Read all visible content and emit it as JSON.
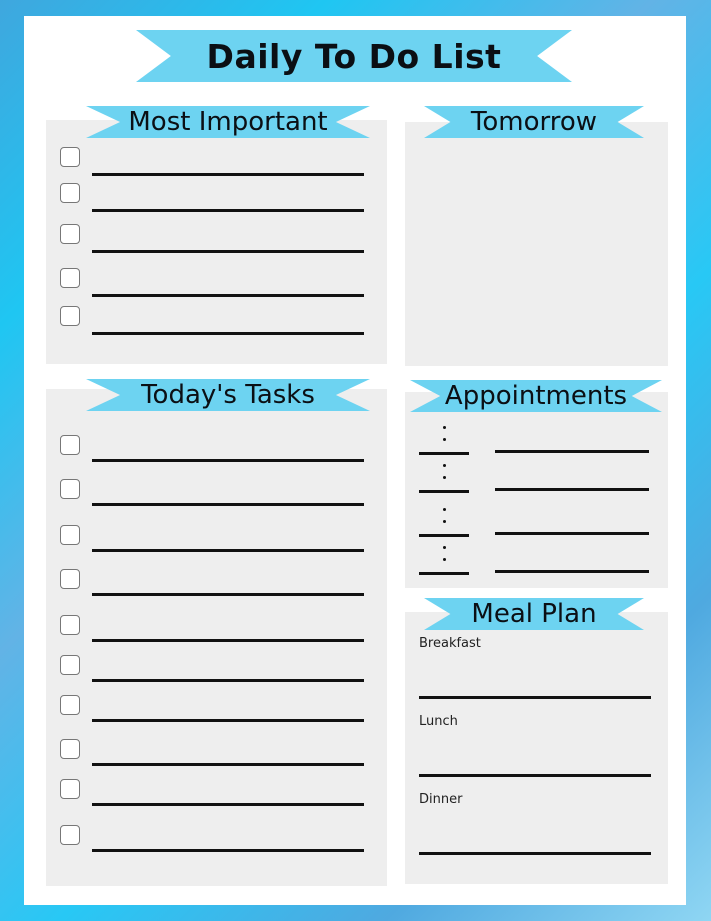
{
  "colors": {
    "ribbon": "#6dd3f1",
    "panel": "#eeeeee",
    "paper": "#ffffff",
    "border_accent": "#1fc6f2"
  },
  "title": "Daily To Do List",
  "sections": {
    "most_important": {
      "label": "Most Important",
      "checkbox_count": 5,
      "checked": [
        false,
        false,
        false,
        false,
        false
      ]
    },
    "tomorrow": {
      "label": "Tomorrow"
    },
    "todays_tasks": {
      "label": "Today's Tasks",
      "checkbox_count": 10,
      "checked": [
        false,
        false,
        false,
        false,
        false,
        false,
        false,
        false,
        false,
        false
      ]
    },
    "appointments": {
      "label": "Appointments",
      "time_separator": ":",
      "row_count": 4
    },
    "meal_plan": {
      "label": "Meal Plan",
      "meals": [
        "Breakfast",
        "Lunch",
        "Dinner"
      ]
    }
  }
}
